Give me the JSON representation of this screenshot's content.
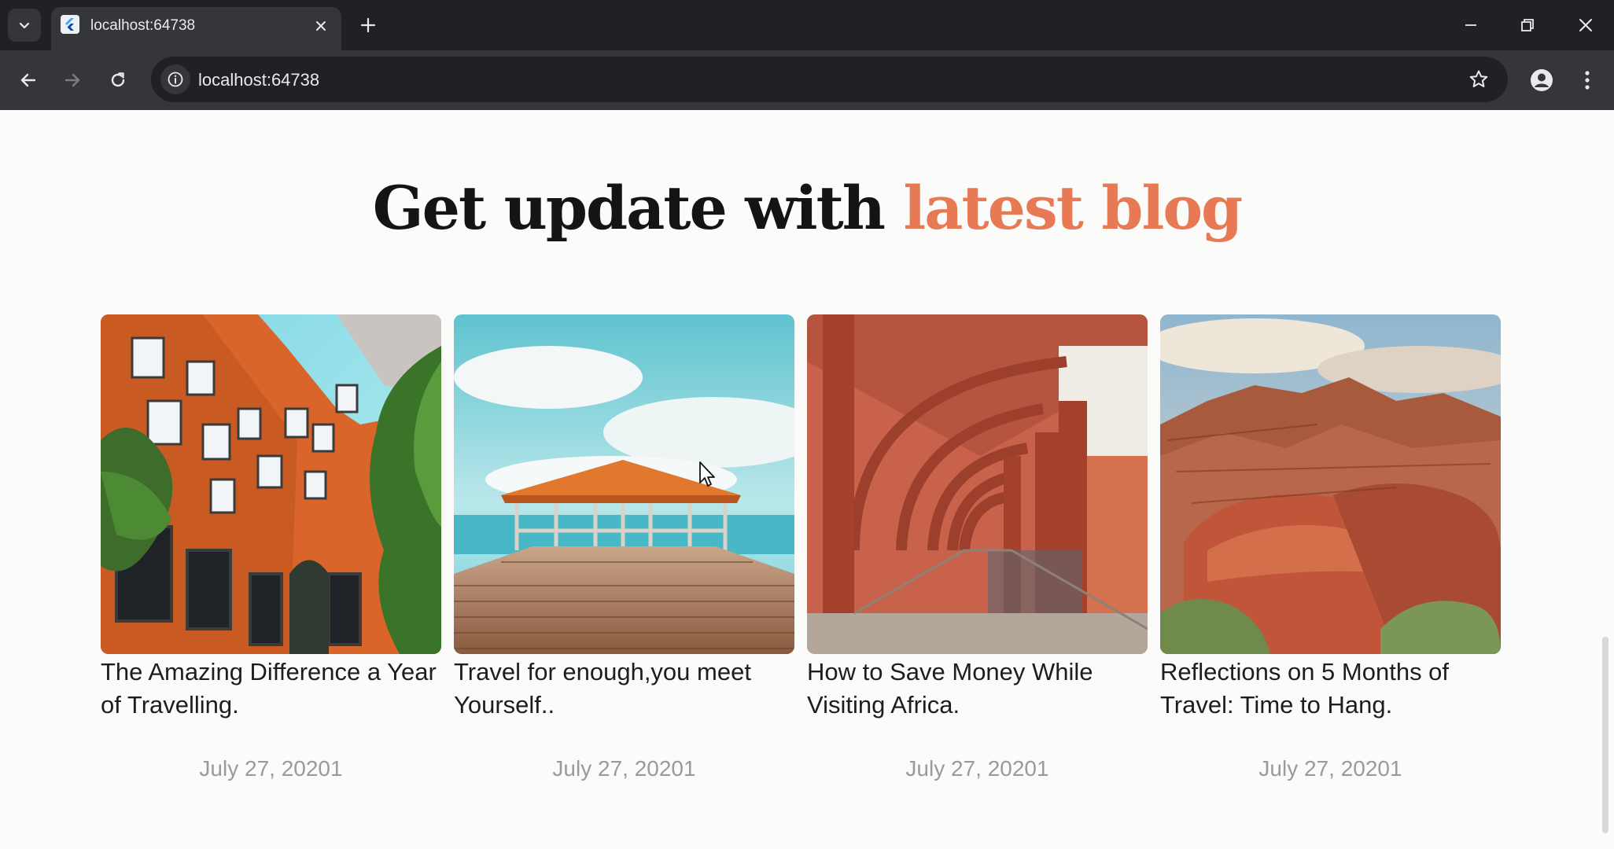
{
  "browser": {
    "tab_title": "localhost:64738",
    "url": "localhost:64738",
    "icons": {
      "tab_search": "chevron-down-icon",
      "tab_close": "close-icon",
      "new_tab": "plus-icon",
      "minimize": "minimize-icon",
      "restore": "restore-icon",
      "close_window": "close-icon",
      "back": "back-arrow-icon",
      "forward": "forward-arrow-icon",
      "reload": "reload-icon",
      "site_info": "info-icon",
      "bookmark": "star-icon",
      "profile": "profile-icon",
      "menu": "kebab-menu-icon"
    }
  },
  "section": {
    "heading_plain": "Get update with ",
    "heading_accent": "latest blog",
    "accent_color": "#e77a55"
  },
  "posts": [
    {
      "title": "The Amazing Difference a Year of Travelling.",
      "date": "July 27, 20201",
      "image": "orange-building-courtyard"
    },
    {
      "title": "Travel for enough,you meet Yourself..",
      "date": "July 27, 20201",
      "image": "pier-gazebo-sea"
    },
    {
      "title": "How to Save Money While Visiting Africa.",
      "date": "July 27, 20201",
      "image": "arched-colonnade"
    },
    {
      "title": "Reflections on 5 Months of Travel: Time to Hang.",
      "date": "July 27, 20201",
      "image": "red-rock-canyon"
    }
  ]
}
